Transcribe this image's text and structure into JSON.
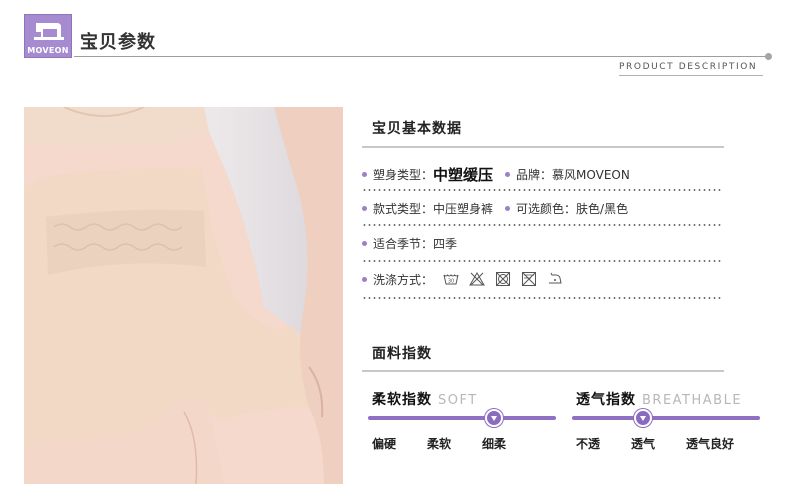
{
  "header": {
    "logo_text": "MOVEON",
    "title": "宝贝参数",
    "subtitle": "PRODUCT DESCRIPTION"
  },
  "photo": {
    "icon": "product-photo"
  },
  "basic": {
    "title": "宝贝基本数据",
    "rows": [
      {
        "label": "塑身类型：",
        "value": "中塑缓压",
        "label2": "品牌：",
        "value2": "慕风MOVEON"
      },
      {
        "label": "款式类型：",
        "value": "中压塑身裤",
        "label2": "可选颜色：",
        "value2": "肤色/黑色"
      },
      {
        "label": "适合季节：",
        "value": "四季"
      },
      {
        "label": "洗涤方式：",
        "icons": [
          "wash-30-icon",
          "no-bleach-icon",
          "no-tumble-dry-icon",
          "no-dry-clean-icon",
          "low-iron-icon"
        ]
      }
    ]
  },
  "fabric": {
    "title": "面料指数",
    "softness": {
      "title": "柔软指数",
      "title_en": "SOFT",
      "scale": [
        "偏硬",
        "柔软",
        "细柔"
      ],
      "selected_index": 2
    },
    "breathability": {
      "title": "透气指数",
      "title_en": "BREATHABLE",
      "scale": [
        "不透",
        "透气",
        "透气良好"
      ],
      "selected_index": 1
    }
  },
  "colors": {
    "accent": "#8f70c3",
    "logo_bg": "#a78bd0"
  }
}
